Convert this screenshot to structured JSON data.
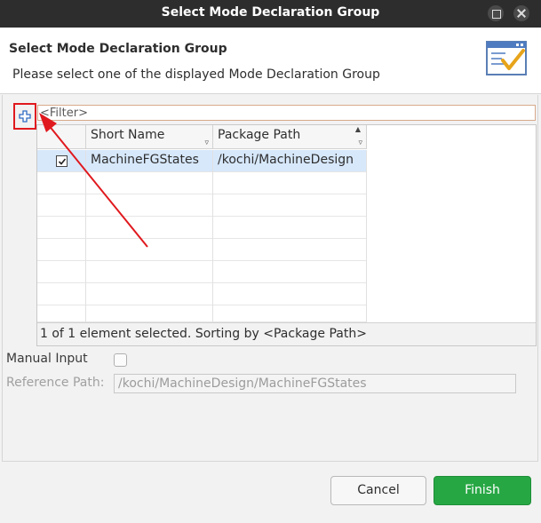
{
  "window": {
    "title": "Select Mode Declaration Group"
  },
  "header": {
    "title": "Select Mode Declaration Group",
    "description": "Please select one of the displayed Mode Declaration Group",
    "icon": "wizard-checklist-icon"
  },
  "filter": {
    "value": "<Filter>"
  },
  "table": {
    "columns": [
      {
        "label": ""
      },
      {
        "label": "Short Name"
      },
      {
        "label": "Package Path"
      }
    ],
    "rows": [
      {
        "checked": true,
        "short_name": "MachineFGStates",
        "package_path": "/kochi/MachineDesign"
      }
    ],
    "status": "1 of 1 element selected. Sorting by <Package Path>"
  },
  "form": {
    "manual_input_label": "Manual Input",
    "manual_input_checked": false,
    "reference_path_label": "Reference Path:",
    "reference_path_value": "/kochi/MachineDesign/MachineFGStates"
  },
  "buttons": {
    "cancel": "Cancel",
    "finish": "Finish"
  },
  "colors": {
    "accent_green": "#27a744",
    "annotation_red": "#e0191e",
    "selection": "#d7e8fb"
  }
}
